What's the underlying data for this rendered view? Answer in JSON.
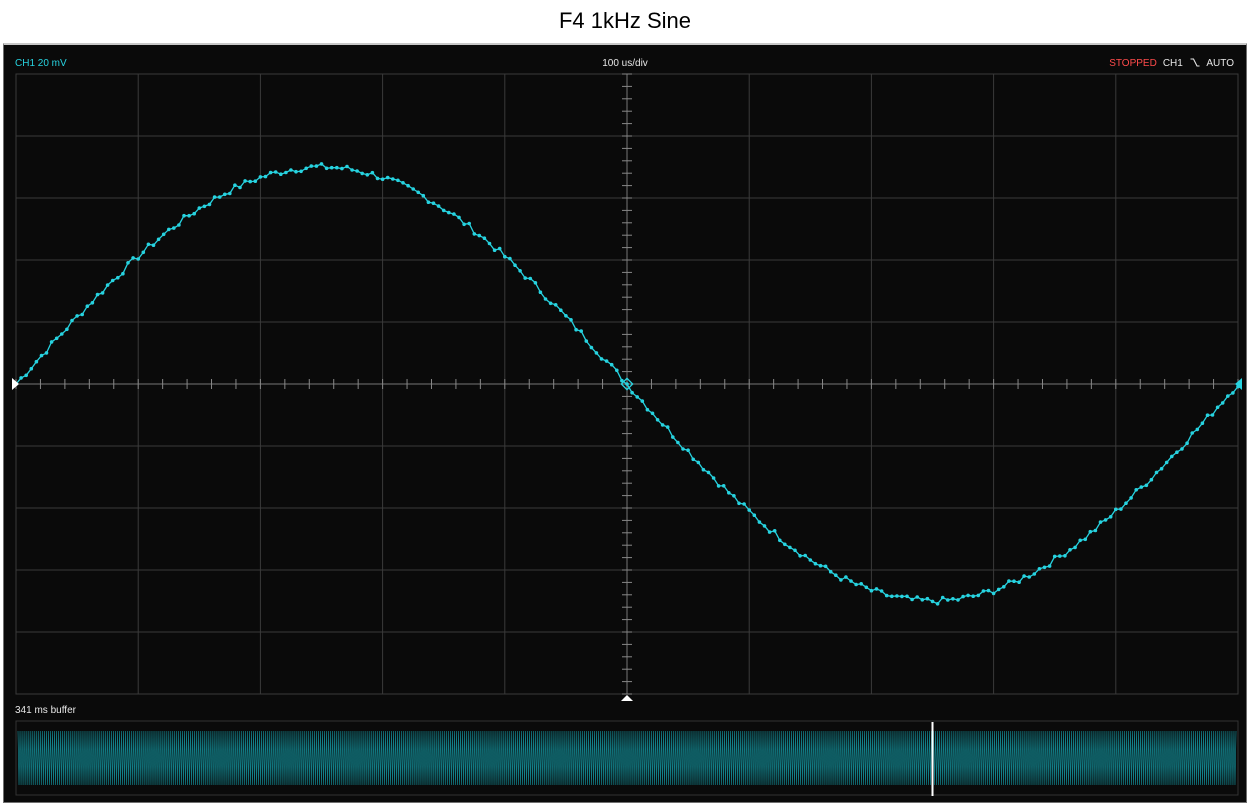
{
  "title": "F4 1kHz Sine",
  "header": {
    "channel_label": "CH1 20 mV",
    "timebase": "100 us/div",
    "status": "STOPPED",
    "trigger_channel": "CH1",
    "trigger_edge_icon": "falling-edge-icon",
    "trigger_mode": "AUTO"
  },
  "buffer": {
    "label": "341 ms buffer",
    "position": 0.75
  },
  "colors": {
    "trace": "#27d3e0",
    "stopped": "#ff4b4b",
    "grid": "#3a3a3a",
    "text": "#e8e8e8"
  },
  "chart_data": {
    "type": "line",
    "xlabel": "",
    "ylabel": "",
    "divisions": {
      "x": 10,
      "y": 10
    },
    "xlim": [
      -500,
      500
    ],
    "ylim": [
      -100,
      100
    ],
    "series": [
      {
        "frequency_hz": 1000,
        "amplitude_mv": 70,
        "phase": "falling zero crossing at 0 us",
        "samples": 240
      }
    ]
  }
}
